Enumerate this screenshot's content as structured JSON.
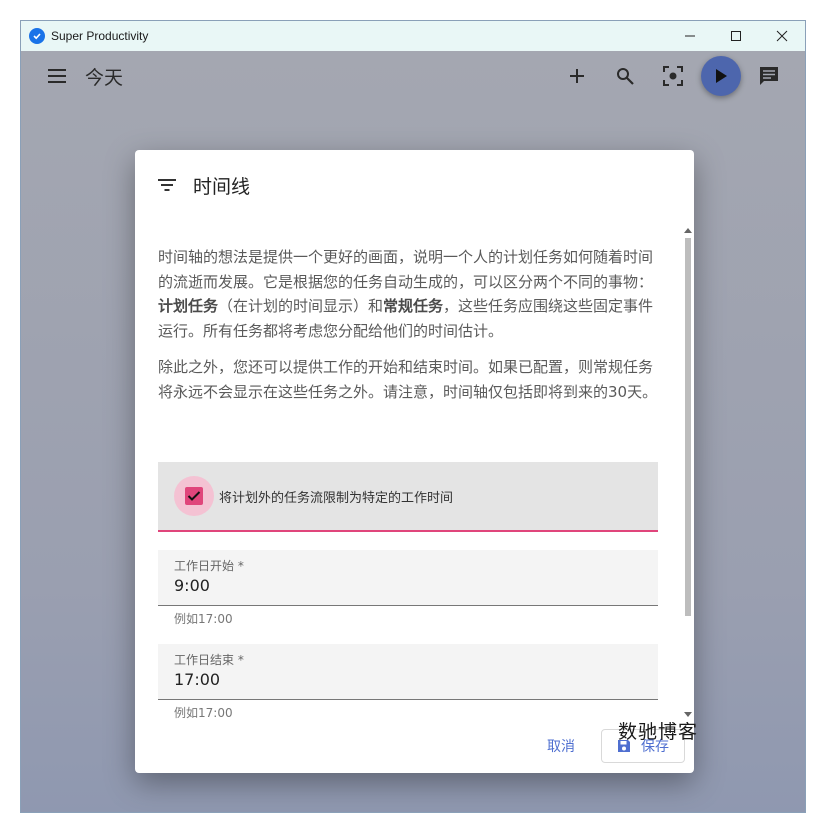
{
  "window": {
    "title": "Super Productivity"
  },
  "toolbar": {
    "page_title": "今天"
  },
  "dialog": {
    "title": "时间线",
    "intro": {
      "part1": "时间轴的想法是提供一个更好的画面，说明一个人的计划任务如何随着时间的流逝而发展。它是根据您的任务自动生成的，可以区分两个不同的事物：",
      "bold1": "计划任务",
      "part2": "（在计划的时间显示）和",
      "bold2": "常规任务",
      "part3": "，这些任务应围绕这些固定事件运行。所有任务都将考虑您分配给他们的时间估计。"
    },
    "para2": "除此之外，您还可以提供工作的开始和结束时间。如果已配置，则常规任务将永远不会显示在这些任务之外。请注意，时间轴仅包括即将到来的30天。",
    "checkbox": {
      "label": "将计划外的任务流限制为特定的工作时间",
      "checked": true
    },
    "work_start": {
      "label": "工作日开始 *",
      "value": "9:00",
      "hint": "例如17:00"
    },
    "work_end": {
      "label": "工作日结束 *",
      "value": "17:00",
      "hint": "例如17:00"
    },
    "cancel_label": "取消",
    "save_label": "保存"
  },
  "watermark": "数驰博客",
  "colors": {
    "accent": "#e0457b",
    "primary": "#4d66ad",
    "link": "#4f6fd0"
  }
}
